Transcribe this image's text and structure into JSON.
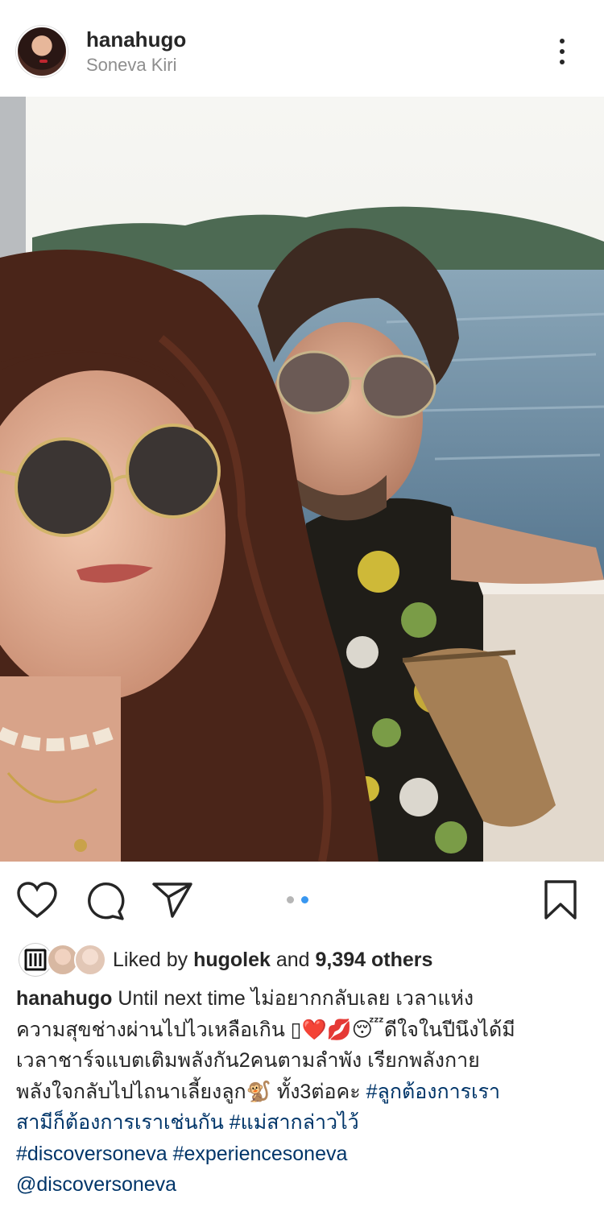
{
  "post": {
    "username": "hanahugo",
    "location": "Soneva Kiri"
  },
  "icons": {
    "more": "more-vertical-icon",
    "like": "heart-icon",
    "comment": "comment-bubble-icon",
    "share": "paper-plane-icon",
    "save": "bookmark-icon"
  },
  "carousel": {
    "total": 2,
    "active": 2
  },
  "colors": {
    "accent": "#3897f0",
    "hashtag": "#003569",
    "muted": "#8e8e8e",
    "text": "#262626"
  },
  "likes": {
    "prefix": "Liked by ",
    "user": "hugolek",
    "middle": " and ",
    "others": "9,394 others"
  },
  "caption": {
    "user": "hanahugo",
    "line1_text": " Until next time ไม่อยากกลับเลย เวลาแห่ง",
    "line2_text": "ความสุขช่างผ่านไปไวเหลือเกิน ▯❤️💋😴ดีใจในปีนึงได้มี",
    "line3_text": "เวลาชาร์จแบตเติมพลังกัน2คนตามลำพัง เรียกพลังกาย",
    "line4_text": "พลังใจกลับไปไถนาเลี้ยงลูก🐒 ทั้ง3ต่อคะ ",
    "tag1": "#ลูกต้องการเรา",
    "tag1b": "สามีก็ต้องการเราเช่นกัน",
    "tag2": " #แม่สากล่าวไว้",
    "tag3": "#discoversoneva",
    "tag4": " #experiencesoneva",
    "mention": "@discoversoneva"
  }
}
